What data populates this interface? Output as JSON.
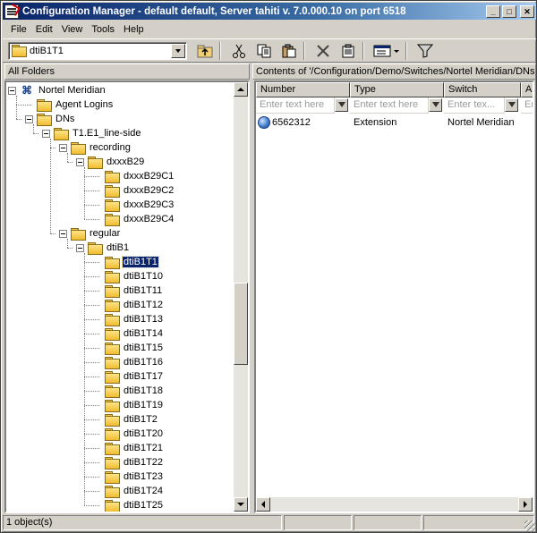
{
  "window": {
    "title": "Configuration Manager - default default, Server tahiti v. 7.0.000.10 on port 6518"
  },
  "menu": [
    {
      "label": "File",
      "key": "F"
    },
    {
      "label": "Edit",
      "key": "E"
    },
    {
      "label": "View",
      "key": "V"
    },
    {
      "label": "Tools",
      "key": "T"
    },
    {
      "label": "Help",
      "key": "H"
    }
  ],
  "toolbar": {
    "location_value": "dtiB1T1",
    "buttons": [
      "up-folder-icon",
      "cut-icon",
      "copy-icon",
      "paste-icon",
      "delete-icon",
      "properties-icon",
      "view-icon",
      "filter-icon"
    ]
  },
  "left_panel": {
    "header": "All Folders"
  },
  "right_panel": {
    "header": "Contents of '/Configuration/Demo/Switches/Nortel Meridian/DNs.T"
  },
  "tree": [
    {
      "label": "Nortel Meridian",
      "icon": "switch-icon",
      "expanded": true
    },
    {
      "label": "Agent Logins",
      "icon": "folder-icon"
    },
    {
      "label": "DNs",
      "icon": "folder-icon",
      "expanded": true
    },
    {
      "label": "T1.E1_line-side",
      "icon": "folder-icon",
      "expanded": true
    },
    {
      "label": "recording",
      "icon": "folder-icon",
      "expanded": true
    },
    {
      "label": "dxxxB29",
      "icon": "folder-icon",
      "expanded": true
    },
    {
      "label": "dxxxB29C1",
      "icon": "folder-icon"
    },
    {
      "label": "dxxxB29C2",
      "icon": "folder-icon"
    },
    {
      "label": "dxxxB29C3",
      "icon": "folder-icon"
    },
    {
      "label": "dxxxB29C4",
      "icon": "folder-icon"
    },
    {
      "label": "regular",
      "icon": "folder-icon",
      "expanded": true
    },
    {
      "label": "dtiB1",
      "icon": "folder-icon",
      "expanded": true
    },
    {
      "label": "dtiB1T1",
      "icon": "open-folder-icon",
      "selected": true
    },
    {
      "label": "dtiB1T10",
      "icon": "folder-icon"
    },
    {
      "label": "dtiB1T11",
      "icon": "folder-icon"
    },
    {
      "label": "dtiB1T12",
      "icon": "folder-icon"
    },
    {
      "label": "dtiB1T13",
      "icon": "folder-icon"
    },
    {
      "label": "dtiB1T14",
      "icon": "folder-icon"
    },
    {
      "label": "dtiB1T15",
      "icon": "folder-icon"
    },
    {
      "label": "dtiB1T16",
      "icon": "folder-icon"
    },
    {
      "label": "dtiB1T17",
      "icon": "folder-icon"
    },
    {
      "label": "dtiB1T18",
      "icon": "folder-icon"
    },
    {
      "label": "dtiB1T19",
      "icon": "folder-icon"
    },
    {
      "label": "dtiB1T2",
      "icon": "folder-icon"
    },
    {
      "label": "dtiB1T20",
      "icon": "folder-icon"
    },
    {
      "label": "dtiB1T21",
      "icon": "folder-icon"
    },
    {
      "label": "dtiB1T22",
      "icon": "folder-icon"
    },
    {
      "label": "dtiB1T23",
      "icon": "folder-icon"
    },
    {
      "label": "dtiB1T24",
      "icon": "folder-icon"
    },
    {
      "label": "dtiB1T25",
      "icon": "folder-icon"
    }
  ],
  "table": {
    "columns": [
      "Number",
      "Type",
      "Switch",
      "Al"
    ],
    "filter_placeholders": [
      "Enter text here",
      "Enter text here",
      "Enter tex...",
      "Ent"
    ],
    "rows": [
      {
        "number": "6562312",
        "type": "Extension",
        "switch": "Nortel Meridian",
        "icon": "dn-icon"
      }
    ]
  },
  "status": {
    "text": "1 object(s)"
  }
}
